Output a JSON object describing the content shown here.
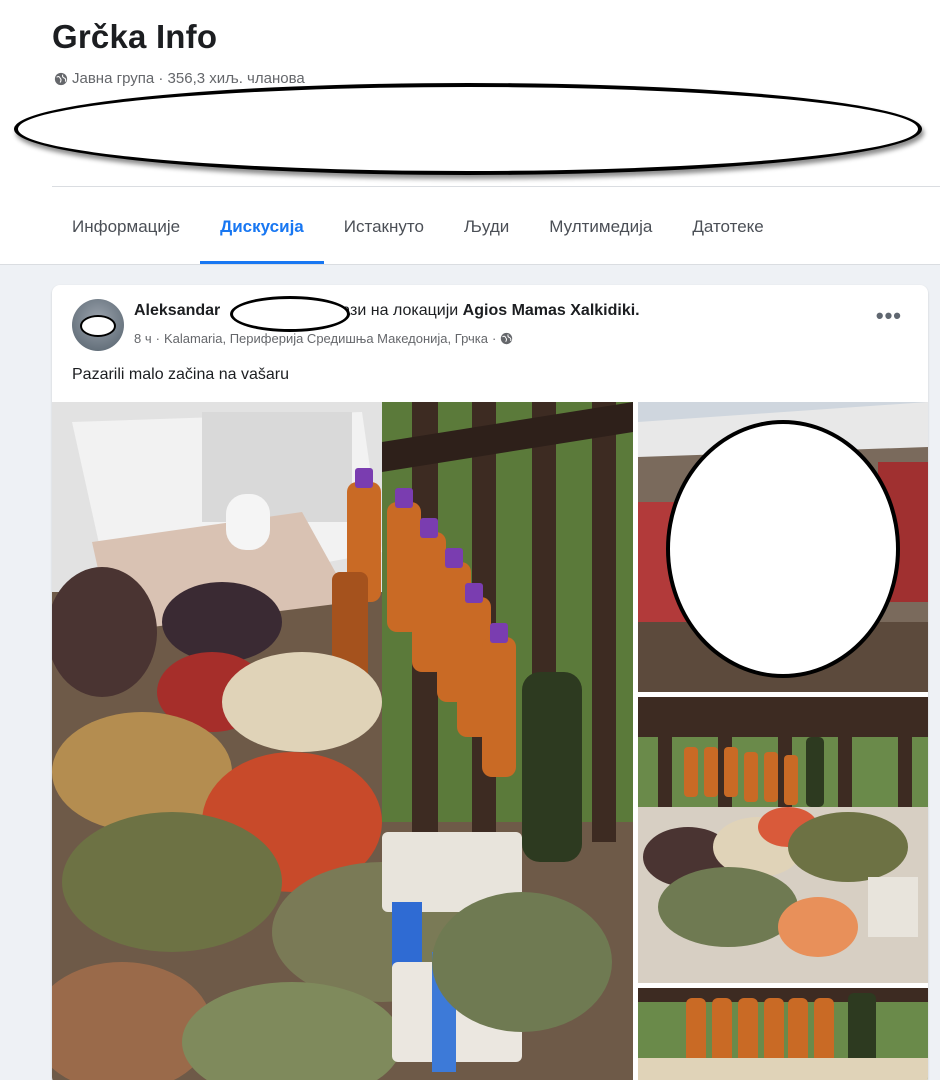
{
  "group": {
    "title": "Grčka Info",
    "meta": "Јавна група · 356,3 хиљ. чланова"
  },
  "tabs": [
    {
      "label": "Информације",
      "active": false
    },
    {
      "label": "Дискусија",
      "active": true
    },
    {
      "label": "Истакнуто",
      "active": false
    },
    {
      "label": "Људи",
      "active": false
    },
    {
      "label": "Мултимедија",
      "active": false
    },
    {
      "label": "Датотеке",
      "active": false
    }
  ],
  "post": {
    "author_first": "Aleksandar",
    "author_suffix": "налази на локацији",
    "location": "Agios Mamas Xalkidiki.",
    "time": "8 ч",
    "place": "Kalamaria, Периферија Средишња Македонија, Грчка",
    "text": "Pazarili malo začina na vašaru",
    "more_label": "•••"
  },
  "colors": {
    "accent": "#1877f2",
    "text": "#1c1e21",
    "secondary_text": "#65676b",
    "background": "#eef1f5"
  }
}
